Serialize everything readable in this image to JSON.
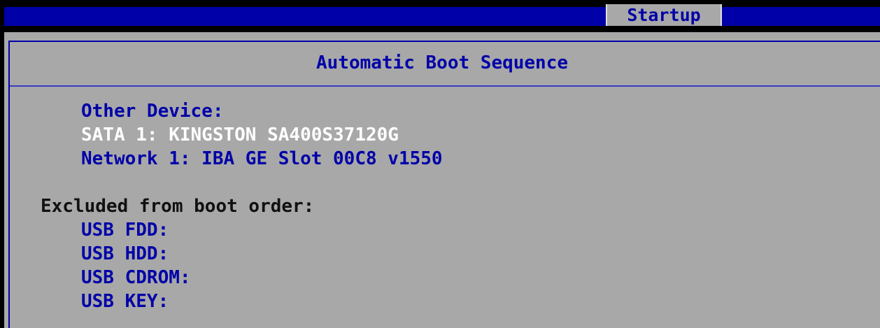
{
  "header": {
    "tab_label": "Startup"
  },
  "panel": {
    "title": "Automatic Boot Sequence"
  },
  "boot_sequence": {
    "other_device_label": "Other Device:",
    "devices": [
      "SATA 1: KINGSTON SA400S37120G",
      "Network 1: IBA GE Slot 00C8 v1550"
    ],
    "selected_index": 0
  },
  "excluded": {
    "heading": "Excluded from boot order:",
    "items": [
      "USB FDD:",
      "USB HDD:",
      "USB CDROM:",
      "USB KEY:"
    ]
  },
  "colors": {
    "background": "#000000",
    "panel": "#a8a8a8",
    "accent_blue": "#0000a8",
    "selected_text": "#ffffff",
    "heading_text": "#101010"
  }
}
